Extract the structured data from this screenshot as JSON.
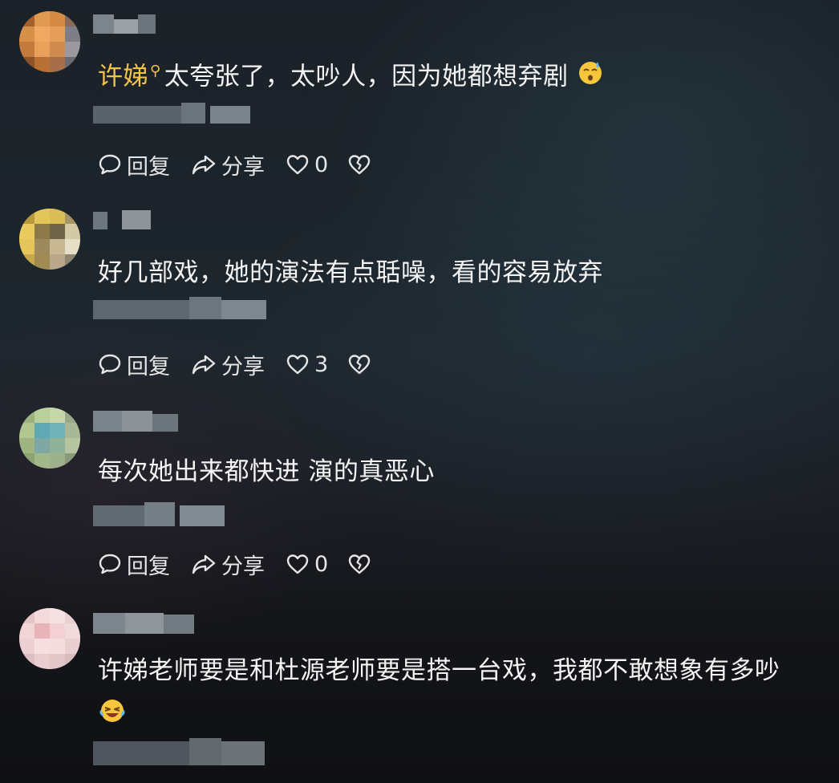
{
  "comments": [
    {
      "author_label": "许娣",
      "text": "太夸张了，太吵人，因为她都想弃剧",
      "likes": "0",
      "reply_label": "回复",
      "share_label": "分享",
      "emoji": "cold-sweat-emoji"
    },
    {
      "text": "好几部戏，她的演法有点聒噪，看的容易放弃",
      "likes": "3",
      "reply_label": "回复",
      "share_label": "分享"
    },
    {
      "text": "每次她出来都快进 演的真恶心",
      "likes": "0",
      "reply_label": "回复",
      "share_label": "分享"
    },
    {
      "text": "许娣老师要是和杜源老师要是搭一台戏，我都不敢想象有多吵",
      "emoji": "crying-laughing-emoji"
    }
  ],
  "colors": {
    "author_name": "#f2c34b",
    "text": "#f4f4f4",
    "action": "#e6e6e6"
  },
  "icons": [
    "comment-bubble-icon",
    "share-arrow-icon",
    "heart-icon",
    "broken-heart-icon"
  ]
}
